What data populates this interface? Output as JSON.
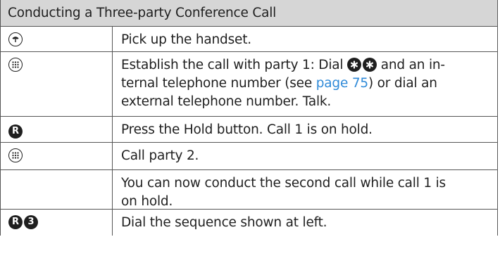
{
  "title": "Conducting a Three-party Conference Call",
  "rows": [
    {
      "icons": [
        "handset-up-icon"
      ],
      "text": "Pick up the handset."
    },
    {
      "icons": [
        "keypad-icon"
      ],
      "text_a": "Establish the call with party 1: Dial",
      "inline_icons": [
        "star-key-icon",
        "star-key-icon"
      ],
      "text_b": "and an in-",
      "text_c": "ternal telephone number (see",
      "link": "page 75",
      "text_d": ") or dial an",
      "text_e": "external telephone number. Talk."
    },
    {
      "icons": [
        "r-key-icon"
      ],
      "text": "Press the Hold button. Call 1 is on hold."
    },
    {
      "icons": [
        "keypad-icon"
      ],
      "text": "Call party 2."
    },
    {
      "icons": [],
      "text_a": "You can now conduct the second call while call 1 is",
      "text_b": "on hold."
    },
    {
      "icons": [
        "r-key-icon",
        "three-key-icon"
      ],
      "text": "Dial the sequence shown at left."
    }
  ],
  "colors": {
    "title_bg": "#d6d6d6",
    "border": "#555555",
    "link": "#2f8ad8",
    "text": "#1f1f1f"
  }
}
